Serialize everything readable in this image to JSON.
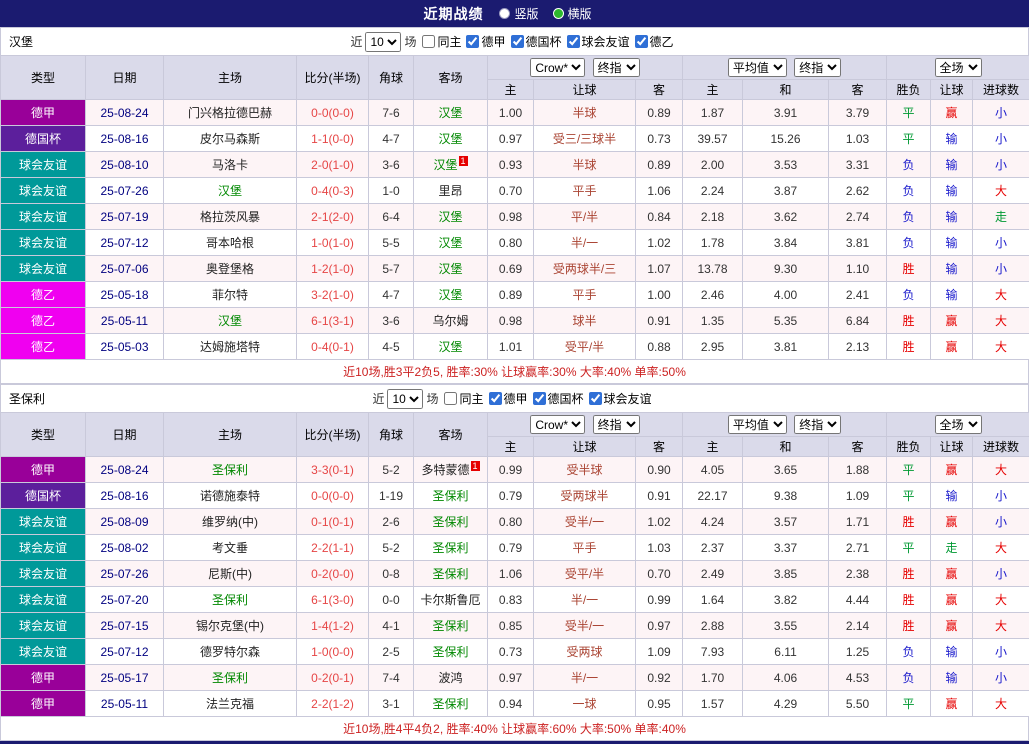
{
  "title_bar": {
    "title": "近期战绩",
    "radio_options": [
      {
        "label": "竖版",
        "selected": false
      },
      {
        "label": "横版",
        "selected": true
      }
    ]
  },
  "colors": {
    "title_bar_bg": "#1b1b70",
    "header_bg": "#dadaea",
    "focus_team": "#008800",
    "score_text": "#e64545",
    "handicap_text": "#aa4433",
    "date_text": "#000080",
    "summary_text": "#cc2222",
    "radio_selected": "#2db82d"
  },
  "type_colors": {
    "德甲": "#990099",
    "德国杯": "#5c1f9c",
    "球会友谊": "#009999",
    "德乙": "#f000f0"
  },
  "result_colors": {
    "win": "#e60000",
    "draw": "#009933",
    "loss": "#1a1acc"
  },
  "table_header": {
    "static_cols": [
      "类型",
      "日期",
      "主场",
      "比分(半场)",
      "角球",
      "客场"
    ],
    "odds_group": {
      "company_select": "Crow*",
      "period_select": "终指",
      "subcols": [
        "主",
        "让球",
        "客"
      ]
    },
    "avg_group": {
      "company_select": "平均值",
      "period_select": "终指",
      "subcols": [
        "主",
        "和",
        "客"
      ]
    },
    "result_group": {
      "select": "全场",
      "subcols": [
        "胜负",
        "让球",
        "进球数"
      ]
    }
  },
  "sections": [
    {
      "team": "汉堡",
      "filter": {
        "prefix": "近",
        "count": "10",
        "suffix": "场",
        "checkboxes": [
          {
            "label": "同主",
            "checked": false
          },
          {
            "label": "德甲",
            "checked": true
          },
          {
            "label": "德国杯",
            "checked": true
          },
          {
            "label": "球会友谊",
            "checked": true
          },
          {
            "label": "德乙",
            "checked": true
          }
        ]
      },
      "rows": [
        {
          "type": "德甲",
          "date": "25-08-24",
          "home": {
            "name": "门兴格拉德巴赫",
            "focus": false,
            "sup": ""
          },
          "score": "0-0(0-0)",
          "corners": "7-6",
          "away": {
            "name": "汉堡",
            "focus": true,
            "sup": ""
          },
          "odds": [
            "1.00",
            "半球",
            "0.89"
          ],
          "avg": [
            "1.87",
            "3.91",
            "3.79"
          ],
          "results": [
            {
              "text": "平",
              "c": "draw"
            },
            {
              "text": "赢",
              "c": "win"
            },
            {
              "text": "小",
              "c": "loss"
            }
          ]
        },
        {
          "type": "德国杯",
          "date": "25-08-16",
          "home": {
            "name": "皮尔马森斯",
            "focus": false,
            "sup": ""
          },
          "score": "1-1(0-0)",
          "corners": "4-7",
          "away": {
            "name": "汉堡",
            "focus": true,
            "sup": ""
          },
          "odds": [
            "0.97",
            "受三/三球半",
            "0.73"
          ],
          "avg": [
            "39.57",
            "15.26",
            "1.03"
          ],
          "results": [
            {
              "text": "平",
              "c": "draw"
            },
            {
              "text": "输",
              "c": "loss"
            },
            {
              "text": "小",
              "c": "loss"
            }
          ]
        },
        {
          "type": "球会友谊",
          "date": "25-08-10",
          "home": {
            "name": "马洛卡",
            "focus": false,
            "sup": ""
          },
          "score": "2-0(1-0)",
          "corners": "3-6",
          "away": {
            "name": "汉堡",
            "focus": true,
            "sup": "1"
          },
          "odds": [
            "0.93",
            "半球",
            "0.89"
          ],
          "avg": [
            "2.00",
            "3.53",
            "3.31"
          ],
          "results": [
            {
              "text": "负",
              "c": "loss"
            },
            {
              "text": "输",
              "c": "loss"
            },
            {
              "text": "小",
              "c": "loss"
            }
          ]
        },
        {
          "type": "球会友谊",
          "date": "25-07-26",
          "home": {
            "name": "汉堡",
            "focus": true,
            "sup": ""
          },
          "score": "0-4(0-3)",
          "corners": "1-0",
          "away": {
            "name": "里昂",
            "focus": false,
            "sup": ""
          },
          "odds": [
            "0.70",
            "平手",
            "1.06"
          ],
          "avg": [
            "2.24",
            "3.87",
            "2.62"
          ],
          "results": [
            {
              "text": "负",
              "c": "loss"
            },
            {
              "text": "输",
              "c": "loss"
            },
            {
              "text": "大",
              "c": "win"
            }
          ]
        },
        {
          "type": "球会友谊",
          "date": "25-07-19",
          "home": {
            "name": "格拉茨风暴",
            "focus": false,
            "sup": ""
          },
          "score": "2-1(2-0)",
          "corners": "6-4",
          "away": {
            "name": "汉堡",
            "focus": true,
            "sup": ""
          },
          "odds": [
            "0.98",
            "平/半",
            "0.84"
          ],
          "avg": [
            "2.18",
            "3.62",
            "2.74"
          ],
          "results": [
            {
              "text": "负",
              "c": "loss"
            },
            {
              "text": "输",
              "c": "loss"
            },
            {
              "text": "走",
              "c": "draw"
            }
          ]
        },
        {
          "type": "球会友谊",
          "date": "25-07-12",
          "home": {
            "name": "哥本哈根",
            "focus": false,
            "sup": ""
          },
          "score": "1-0(1-0)",
          "corners": "5-5",
          "away": {
            "name": "汉堡",
            "focus": true,
            "sup": ""
          },
          "odds": [
            "0.80",
            "半/一",
            "1.02"
          ],
          "avg": [
            "1.78",
            "3.84",
            "3.81"
          ],
          "results": [
            {
              "text": "负",
              "c": "loss"
            },
            {
              "text": "输",
              "c": "loss"
            },
            {
              "text": "小",
              "c": "loss"
            }
          ]
        },
        {
          "type": "球会友谊",
          "date": "25-07-06",
          "home": {
            "name": "奥登堡格",
            "focus": false,
            "sup": ""
          },
          "score": "1-2(1-0)",
          "corners": "5-7",
          "away": {
            "name": "汉堡",
            "focus": true,
            "sup": ""
          },
          "odds": [
            "0.69",
            "受两球半/三",
            "1.07"
          ],
          "avg": [
            "13.78",
            "9.30",
            "1.10"
          ],
          "results": [
            {
              "text": "胜",
              "c": "win"
            },
            {
              "text": "输",
              "c": "loss"
            },
            {
              "text": "小",
              "c": "loss"
            }
          ]
        },
        {
          "type": "德乙",
          "date": "25-05-18",
          "home": {
            "name": "菲尔特",
            "focus": false,
            "sup": ""
          },
          "score": "3-2(1-0)",
          "corners": "4-7",
          "away": {
            "name": "汉堡",
            "focus": true,
            "sup": ""
          },
          "odds": [
            "0.89",
            "平手",
            "1.00"
          ],
          "avg": [
            "2.46",
            "4.00",
            "2.41"
          ],
          "results": [
            {
              "text": "负",
              "c": "loss"
            },
            {
              "text": "输",
              "c": "loss"
            },
            {
              "text": "大",
              "c": "win"
            }
          ]
        },
        {
          "type": "德乙",
          "date": "25-05-11",
          "home": {
            "name": "汉堡",
            "focus": true,
            "sup": ""
          },
          "score": "6-1(3-1)",
          "corners": "3-6",
          "away": {
            "name": "乌尔姆",
            "focus": false,
            "sup": ""
          },
          "odds": [
            "0.98",
            "球半",
            "0.91"
          ],
          "avg": [
            "1.35",
            "5.35",
            "6.84"
          ],
          "results": [
            {
              "text": "胜",
              "c": "win"
            },
            {
              "text": "赢",
              "c": "win"
            },
            {
              "text": "大",
              "c": "win"
            }
          ]
        },
        {
          "type": "德乙",
          "date": "25-05-03",
          "home": {
            "name": "达姆施塔特",
            "focus": false,
            "sup": ""
          },
          "score": "0-4(0-1)",
          "corners": "4-5",
          "away": {
            "name": "汉堡",
            "focus": true,
            "sup": ""
          },
          "odds": [
            "1.01",
            "受平/半",
            "0.88"
          ],
          "avg": [
            "2.95",
            "3.81",
            "2.13"
          ],
          "results": [
            {
              "text": "胜",
              "c": "win"
            },
            {
              "text": "赢",
              "c": "win"
            },
            {
              "text": "大",
              "c": "win"
            }
          ]
        }
      ],
      "summary": "近10场,胜3平2负5, 胜率:30% 让球赢率:30% 大率:40% 单率:50%"
    },
    {
      "team": "圣保利",
      "filter": {
        "prefix": "近",
        "count": "10",
        "suffix": "场",
        "checkboxes": [
          {
            "label": "同主",
            "checked": false
          },
          {
            "label": "德甲",
            "checked": true
          },
          {
            "label": "德国杯",
            "checked": true
          },
          {
            "label": "球会友谊",
            "checked": true
          }
        ]
      },
      "rows": [
        {
          "type": "德甲",
          "date": "25-08-24",
          "home": {
            "name": "圣保利",
            "focus": true,
            "sup": ""
          },
          "score": "3-3(0-1)",
          "corners": "5-2",
          "away": {
            "name": "多特蒙德",
            "focus": false,
            "sup": "1"
          },
          "odds": [
            "0.99",
            "受半球",
            "0.90"
          ],
          "avg": [
            "4.05",
            "3.65",
            "1.88"
          ],
          "results": [
            {
              "text": "平",
              "c": "draw"
            },
            {
              "text": "赢",
              "c": "win"
            },
            {
              "text": "大",
              "c": "win"
            }
          ]
        },
        {
          "type": "德国杯",
          "date": "25-08-16",
          "home": {
            "name": "诺德施泰特",
            "focus": false,
            "sup": ""
          },
          "score": "0-0(0-0)",
          "corners": "1-19",
          "away": {
            "name": "圣保利",
            "focus": true,
            "sup": ""
          },
          "odds": [
            "0.79",
            "受两球半",
            "0.91"
          ],
          "avg": [
            "22.17",
            "9.38",
            "1.09"
          ],
          "results": [
            {
              "text": "平",
              "c": "draw"
            },
            {
              "text": "输",
              "c": "loss"
            },
            {
              "text": "小",
              "c": "loss"
            }
          ]
        },
        {
          "type": "球会友谊",
          "date": "25-08-09",
          "home": {
            "name": "维罗纳(中)",
            "focus": false,
            "sup": ""
          },
          "score": "0-1(0-1)",
          "corners": "2-6",
          "away": {
            "name": "圣保利",
            "focus": true,
            "sup": ""
          },
          "odds": [
            "0.80",
            "受半/一",
            "1.02"
          ],
          "avg": [
            "4.24",
            "3.57",
            "1.71"
          ],
          "results": [
            {
              "text": "胜",
              "c": "win"
            },
            {
              "text": "赢",
              "c": "win"
            },
            {
              "text": "小",
              "c": "loss"
            }
          ]
        },
        {
          "type": "球会友谊",
          "date": "25-08-02",
          "home": {
            "name": "考文垂",
            "focus": false,
            "sup": ""
          },
          "score": "2-2(1-1)",
          "corners": "5-2",
          "away": {
            "name": "圣保利",
            "focus": true,
            "sup": ""
          },
          "odds": [
            "0.79",
            "平手",
            "1.03"
          ],
          "avg": [
            "2.37",
            "3.37",
            "2.71"
          ],
          "results": [
            {
              "text": "平",
              "c": "draw"
            },
            {
              "text": "走",
              "c": "draw"
            },
            {
              "text": "大",
              "c": "win"
            }
          ]
        },
        {
          "type": "球会友谊",
          "date": "25-07-26",
          "home": {
            "name": "尼斯(中)",
            "focus": false,
            "sup": ""
          },
          "score": "0-2(0-0)",
          "corners": "0-8",
          "away": {
            "name": "圣保利",
            "focus": true,
            "sup": ""
          },
          "odds": [
            "1.06",
            "受平/半",
            "0.70"
          ],
          "avg": [
            "2.49",
            "3.85",
            "2.38"
          ],
          "results": [
            {
              "text": "胜",
              "c": "win"
            },
            {
              "text": "赢",
              "c": "win"
            },
            {
              "text": "小",
              "c": "loss"
            }
          ]
        },
        {
          "type": "球会友谊",
          "date": "25-07-20",
          "home": {
            "name": "圣保利",
            "focus": true,
            "sup": ""
          },
          "score": "6-1(3-0)",
          "corners": "0-0",
          "away": {
            "name": "卡尔斯鲁厄",
            "focus": false,
            "sup": ""
          },
          "odds": [
            "0.83",
            "半/一",
            "0.99"
          ],
          "avg": [
            "1.64",
            "3.82",
            "4.44"
          ],
          "results": [
            {
              "text": "胜",
              "c": "win"
            },
            {
              "text": "赢",
              "c": "win"
            },
            {
              "text": "大",
              "c": "win"
            }
          ]
        },
        {
          "type": "球会友谊",
          "date": "25-07-15",
          "home": {
            "name": "锡尔克堡(中)",
            "focus": false,
            "sup": ""
          },
          "score": "1-4(1-2)",
          "corners": "4-1",
          "away": {
            "name": "圣保利",
            "focus": true,
            "sup": ""
          },
          "odds": [
            "0.85",
            "受半/一",
            "0.97"
          ],
          "avg": [
            "2.88",
            "3.55",
            "2.14"
          ],
          "results": [
            {
              "text": "胜",
              "c": "win"
            },
            {
              "text": "赢",
              "c": "win"
            },
            {
              "text": "大",
              "c": "win"
            }
          ]
        },
        {
          "type": "球会友谊",
          "date": "25-07-12",
          "home": {
            "name": "德罗特尔森",
            "focus": false,
            "sup": ""
          },
          "score": "1-0(0-0)",
          "corners": "2-5",
          "away": {
            "name": "圣保利",
            "focus": true,
            "sup": ""
          },
          "odds": [
            "0.73",
            "受两球",
            "1.09"
          ],
          "avg": [
            "7.93",
            "6.11",
            "1.25"
          ],
          "results": [
            {
              "text": "负",
              "c": "loss"
            },
            {
              "text": "输",
              "c": "loss"
            },
            {
              "text": "小",
              "c": "loss"
            }
          ]
        },
        {
          "type": "德甲",
          "date": "25-05-17",
          "home": {
            "name": "圣保利",
            "focus": true,
            "sup": ""
          },
          "score": "0-2(0-1)",
          "corners": "7-4",
          "away": {
            "name": "波鸿",
            "focus": false,
            "sup": ""
          },
          "odds": [
            "0.97",
            "半/一",
            "0.92"
          ],
          "avg": [
            "1.70",
            "4.06",
            "4.53"
          ],
          "results": [
            {
              "text": "负",
              "c": "loss"
            },
            {
              "text": "输",
              "c": "loss"
            },
            {
              "text": "小",
              "c": "loss"
            }
          ]
        },
        {
          "type": "德甲",
          "date": "25-05-11",
          "home": {
            "name": "法兰克福",
            "focus": false,
            "sup": ""
          },
          "score": "2-2(1-2)",
          "corners": "3-1",
          "away": {
            "name": "圣保利",
            "focus": true,
            "sup": ""
          },
          "odds": [
            "0.94",
            "一球",
            "0.95"
          ],
          "avg": [
            "1.57",
            "4.29",
            "5.50"
          ],
          "results": [
            {
              "text": "平",
              "c": "draw"
            },
            {
              "text": "赢",
              "c": "win"
            },
            {
              "text": "大",
              "c": "win"
            }
          ]
        }
      ],
      "summary": "近10场,胜4平4负2, 胜率:40% 让球赢率:60% 大率:50% 单率:40%"
    }
  ]
}
